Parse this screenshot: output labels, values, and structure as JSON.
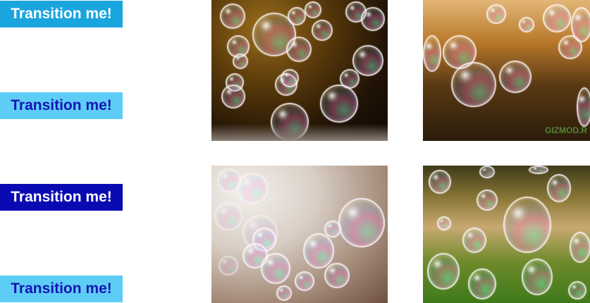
{
  "buttons": [
    {
      "label": "Transition me!"
    },
    {
      "label": "Transition me!"
    },
    {
      "label": "Transition me!"
    },
    {
      "label": "Transition me!"
    }
  ],
  "images": [
    {
      "alt": "bubbles-photo"
    },
    {
      "alt": "bubbles-grass-photo",
      "watermark": "GIZMOD.R"
    },
    {
      "alt": "bubbles-blur-photo"
    },
    {
      "alt": "bubbles-park-photo"
    }
  ],
  "colors": {
    "button1_bg": "#1aa5df",
    "button2_bg": "#5ecdf6",
    "button3_bg": "#0a0ab3",
    "button4_bg": "#5ecdf6",
    "button_text_dark": "#1515b5",
    "button_text_light": "#ffffff"
  }
}
